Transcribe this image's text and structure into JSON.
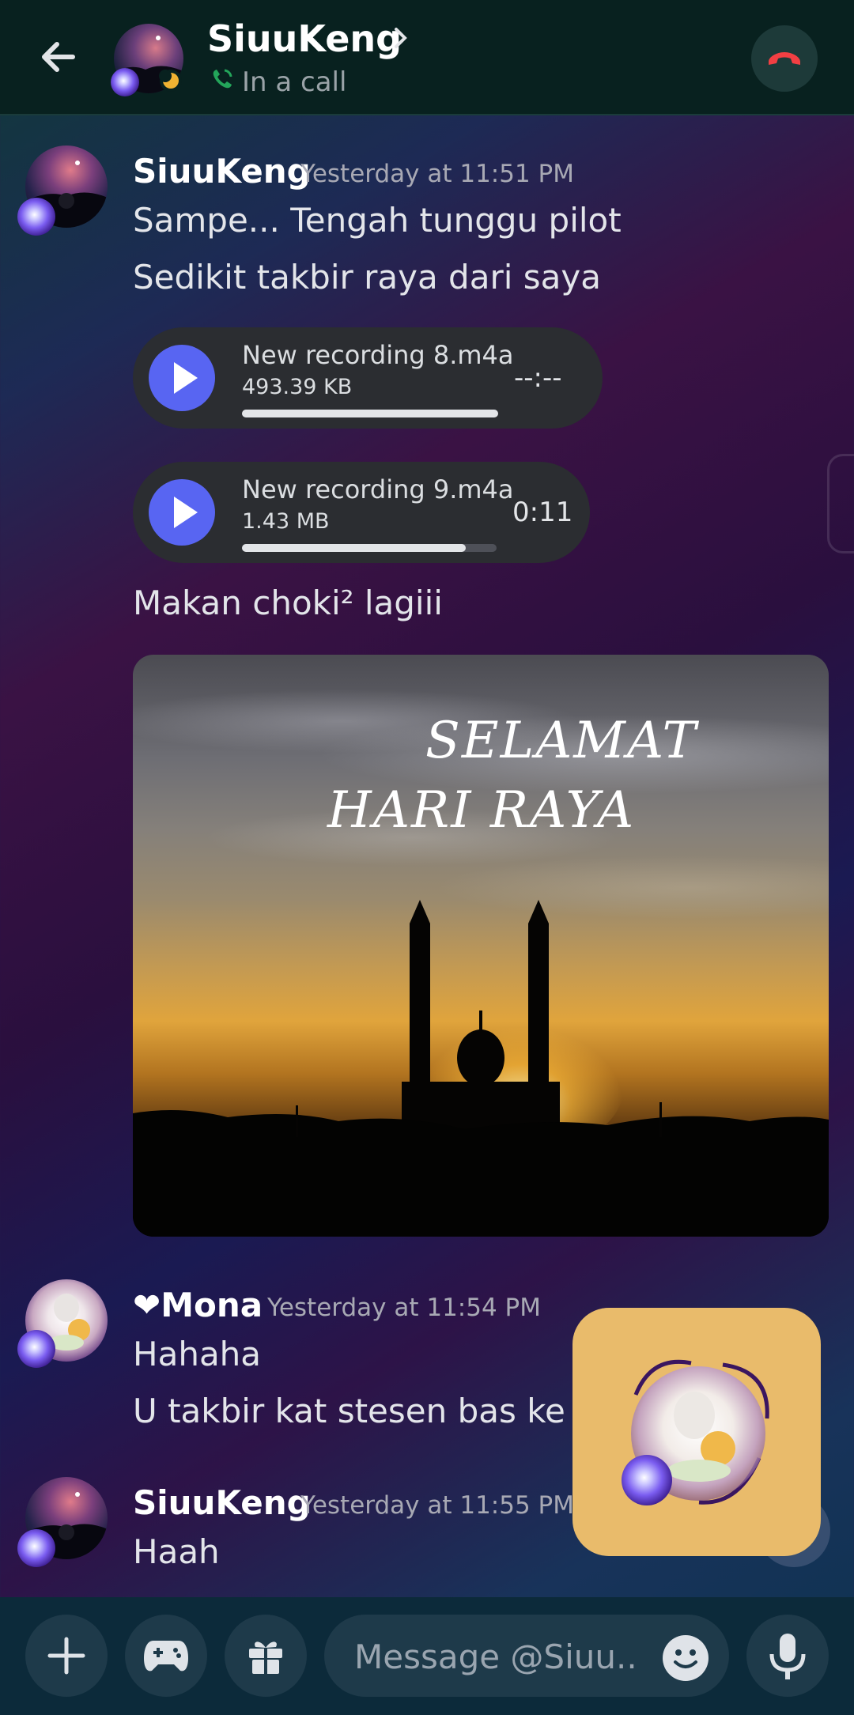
{
  "header": {
    "title": "SiuuKeng",
    "status": "In a call"
  },
  "messages": [
    {
      "author": "SiuuKeng",
      "timestamp": "Yesterday at 11:51 PM",
      "lines": [
        "Sampe... Tengah tunggu pilot",
        "Sedikit takbir raya dari saya"
      ],
      "attachments": [
        {
          "name": "New recording 8.m4a",
          "size": "493.39 KB",
          "time": "--:--",
          "progress": 1.0
        },
        {
          "name": "New recording 9.m4a",
          "size": "1.43 MB",
          "time": "0:11",
          "progress": 0.88
        }
      ],
      "after": "Makan choki² lagiii",
      "image": {
        "line1": "SELAMAT",
        "line2": "HARI RAYA"
      }
    },
    {
      "author": "❤Mona",
      "timestamp": "Yesterday at 11:54 PM",
      "lines": [
        "Hahaha",
        "U takbir kat stesen bas ke"
      ]
    },
    {
      "author": "SiuuKeng",
      "timestamp": "Yesterday at 11:55 PM",
      "lines": [
        "Haah"
      ]
    }
  ],
  "composer": {
    "placeholder": "Message @Siuu..."
  },
  "colors": {
    "accent": "#5865f2",
    "call_green": "#23a55a",
    "end_call_red": "#f23f43",
    "call_tile": "#e9bb6b"
  }
}
